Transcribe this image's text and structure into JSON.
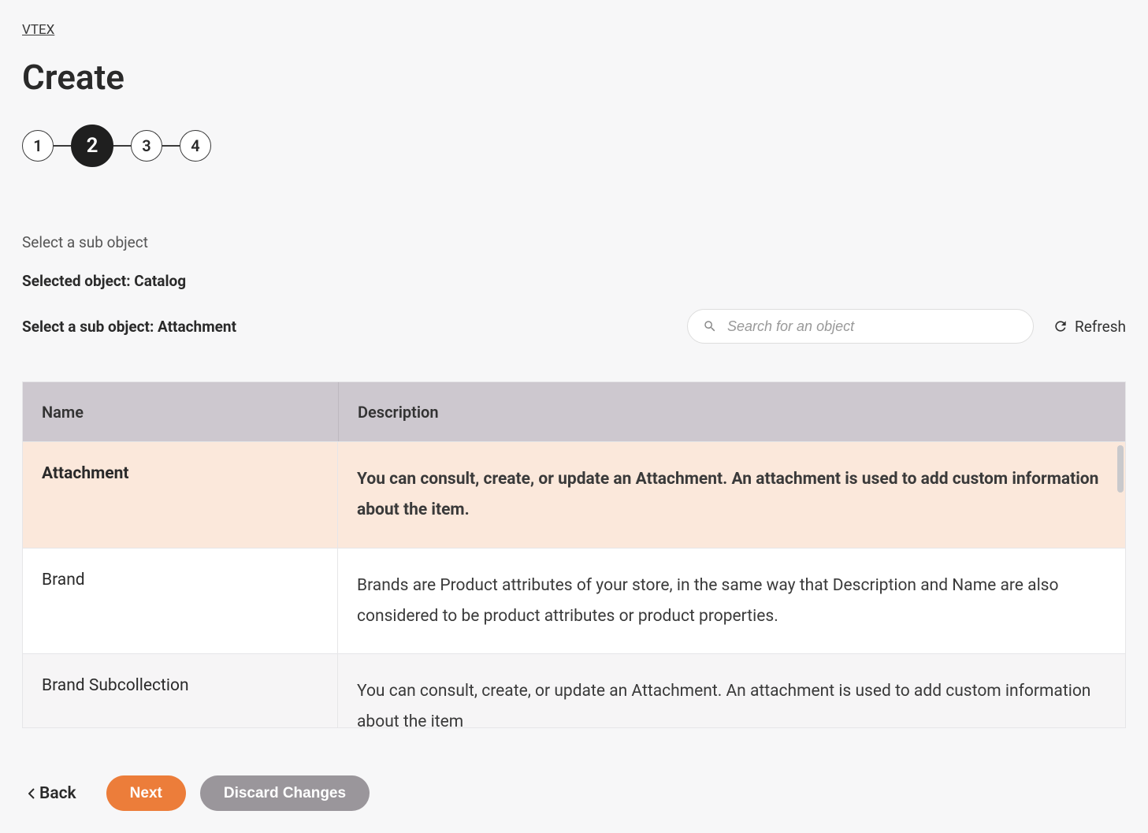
{
  "breadcrumb": "VTEX",
  "title": "Create",
  "stepper": {
    "steps": [
      "1",
      "2",
      "3",
      "4"
    ],
    "active_index": 1
  },
  "instruction": "Select a sub object",
  "selected_object_label": "Selected object: Catalog",
  "sub_object_label": "Select a sub object: Attachment",
  "search": {
    "placeholder": "Search for an object"
  },
  "refresh_label": "Refresh",
  "table": {
    "headers": {
      "name": "Name",
      "description": "Description"
    },
    "rows": [
      {
        "name": "Attachment",
        "description": "You can consult, create, or update an Attachment. An attachment is used to add custom information about the item.",
        "selected": true
      },
      {
        "name": "Brand",
        "description": "Brands are Product attributes of your store, in the same way that Description and Name are also considered to be product attributes or product properties.",
        "selected": false
      },
      {
        "name": "Brand Subcollection",
        "description": "You can consult, create, or update an Attachment. An attachment is used to add custom information about the item",
        "selected": false
      }
    ]
  },
  "footer": {
    "back": "Back",
    "next": "Next",
    "discard": "Discard Changes"
  }
}
